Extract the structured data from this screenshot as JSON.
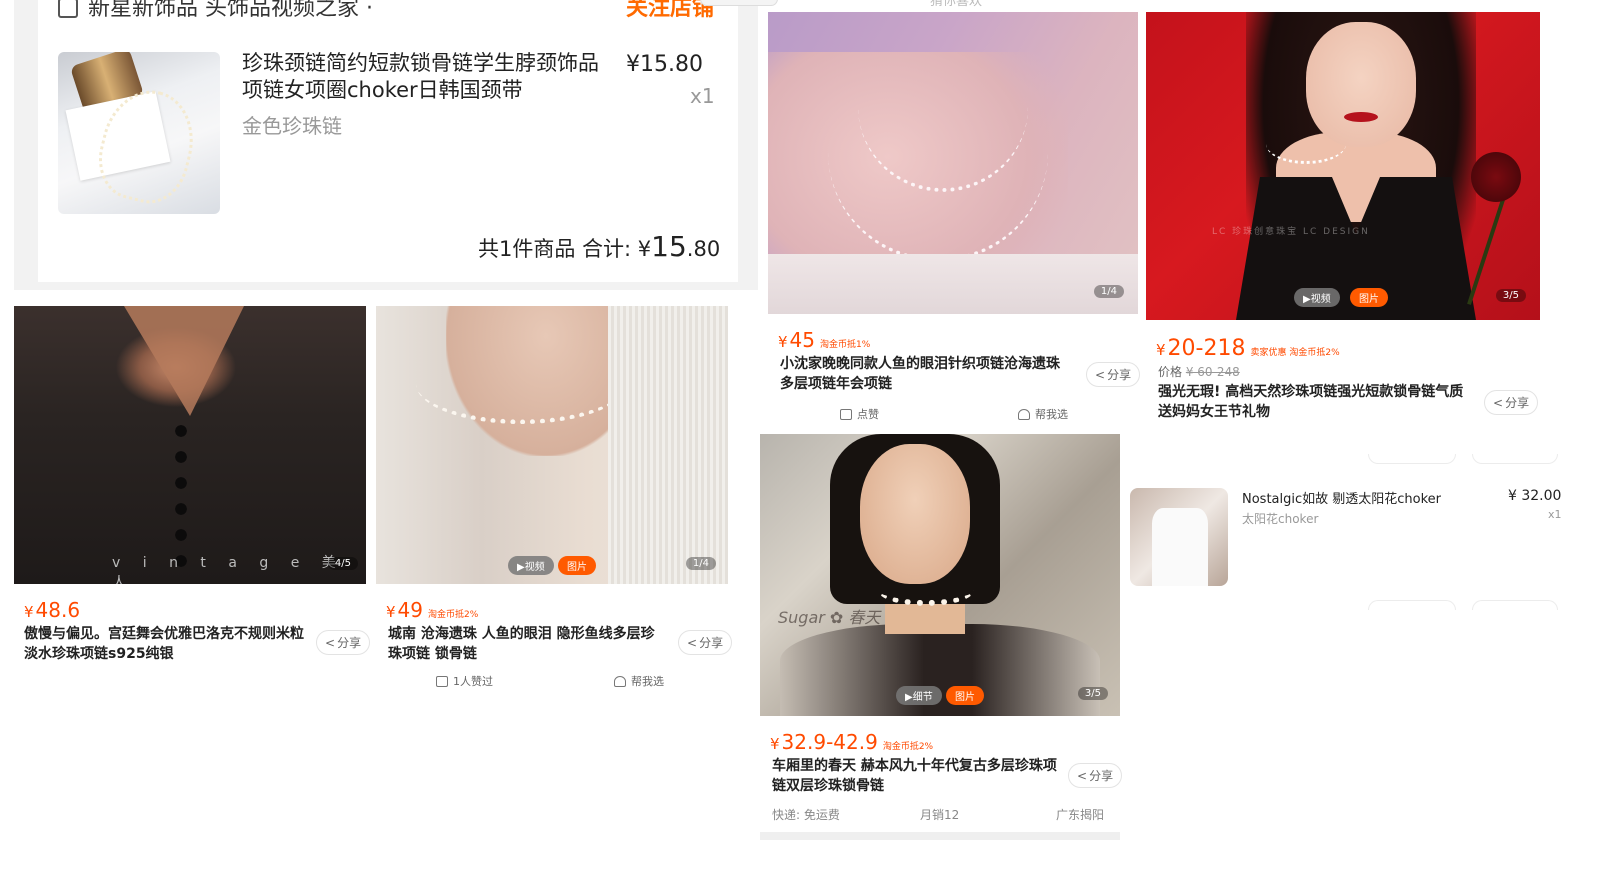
{
  "order": {
    "store_name": "新星新饰品 头饰品视频之家 ·",
    "store_action": "关注店铺",
    "item_title": "珍珠颈链简约短款锁骨链学生脖颈饰品项链女项圈choker日韩国颈带",
    "sku": "金色珍珠链",
    "price": "¥15.80",
    "qty": "x1",
    "total_prefix": "共1件商品  合计: ¥",
    "total_int": "15",
    "total_dec": ".80"
  },
  "top": {
    "hint": "猜你喜欢"
  },
  "products": [
    {
      "price": "48.6",
      "tag": "",
      "title": "傲慢与偏见。宫廷舞会优雅巴洛克不规则米粒淡水珍珠项链s925纯银",
      "share": "分享",
      "watermark": "v i n t a g e 美人",
      "counter": "4/5"
    },
    {
      "price": "49",
      "tag": "淘金币抵2%",
      "title": "城南 沧海遗珠 人鱼的眼泪 隐形鱼线多层珍珠项链 锁骨链",
      "share": "分享",
      "likes": "1人赞过",
      "help": "帮我选",
      "video": "▶视频",
      "pic": "图片",
      "counter": "1/4"
    },
    {
      "price": "45",
      "tag": "淘金币抵1%",
      "title": "小沈家晚晚同款人鱼的眼泪针织项链沧海遗珠多层项链年会项链",
      "share": "分享",
      "likes": "点赞",
      "help": "帮我选",
      "counter": "1/4"
    },
    {
      "price": "20-218",
      "tag": "卖家优惠  淘金币抵2%",
      "orig_label": "价格",
      "orig_price": "¥ 60-248",
      "title": "强光无瑕! 高档天然珍珠项链强光短款锁骨链气质送妈妈女王节礼物",
      "share": "分享",
      "video": "▶视频",
      "pic": "图片",
      "counter": "3/5",
      "watermark": "LC 珍珠创意珠宝  LC DESIGN"
    },
    {
      "price": "32.9-42.9",
      "tag": "淘金币抵2%",
      "title": "车厢里的春天 赫本风九十年代复古多层珍珠项链双层珍珠锁骨链",
      "share": "分享",
      "video": "▶细节",
      "pic": "图片",
      "counter": "3/5",
      "shipping": "快递: 免运费",
      "sales": "月销12",
      "location": "广东揭阳",
      "watermark": "Sugar ✿ 春天"
    }
  ],
  "mini_order": {
    "title": "Nostalgic如故  剔透太阳花choker",
    "sku": "太阳花choker",
    "price": "¥ 32.00",
    "qty": "x1"
  },
  "currency": "¥",
  "colors": {
    "accent": "#ff4a00",
    "brand_orange": "#ff6a00"
  }
}
